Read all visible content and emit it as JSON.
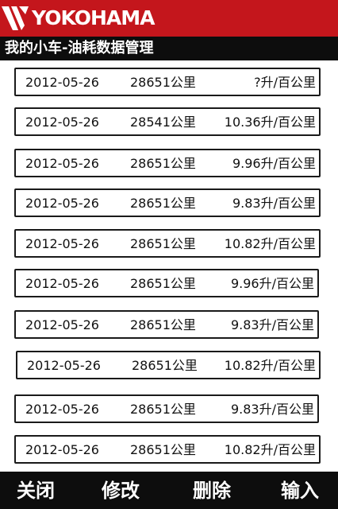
{
  "brand": {
    "name": "YOKOHAMA",
    "logo_icon": "yokohama-logo-icon",
    "color": "#c4161c"
  },
  "page_title": "我的小车-油耗数据管理",
  "records": [
    {
      "date": "2012-05-26",
      "odometer": "28651公里",
      "consumption": "?升/百公里"
    },
    {
      "date": "2012-05-26",
      "odometer": "28541公里",
      "consumption": "10.36升/百公里"
    },
    {
      "date": "2012-05-26",
      "odometer": "28651公里",
      "consumption": "9.96升/百公里"
    },
    {
      "date": "2012-05-26",
      "odometer": "28651公里",
      "consumption": "9.83升/百公里"
    },
    {
      "date": "2012-05-26",
      "odometer": "28651公里",
      "consumption": "10.82升/百公里"
    },
    {
      "date": "2012-05-26",
      "odometer": "28651公里",
      "consumption": "9.96升/百公里"
    },
    {
      "date": "2012-05-26",
      "odometer": "28651公里",
      "consumption": "9.83升/百公里"
    },
    {
      "date": "2012-05-26",
      "odometer": "28651公里",
      "consumption": "10.82升/百公里"
    },
    {
      "date": "2012-05-26",
      "odometer": "28651公里",
      "consumption": "9.83升/百公里"
    },
    {
      "date": "2012-05-26",
      "odometer": "28651公里",
      "consumption": "10.82升/百公里"
    }
  ],
  "actions": {
    "close": "关闭",
    "edit": "修改",
    "delete": "删除",
    "input": "输入"
  }
}
